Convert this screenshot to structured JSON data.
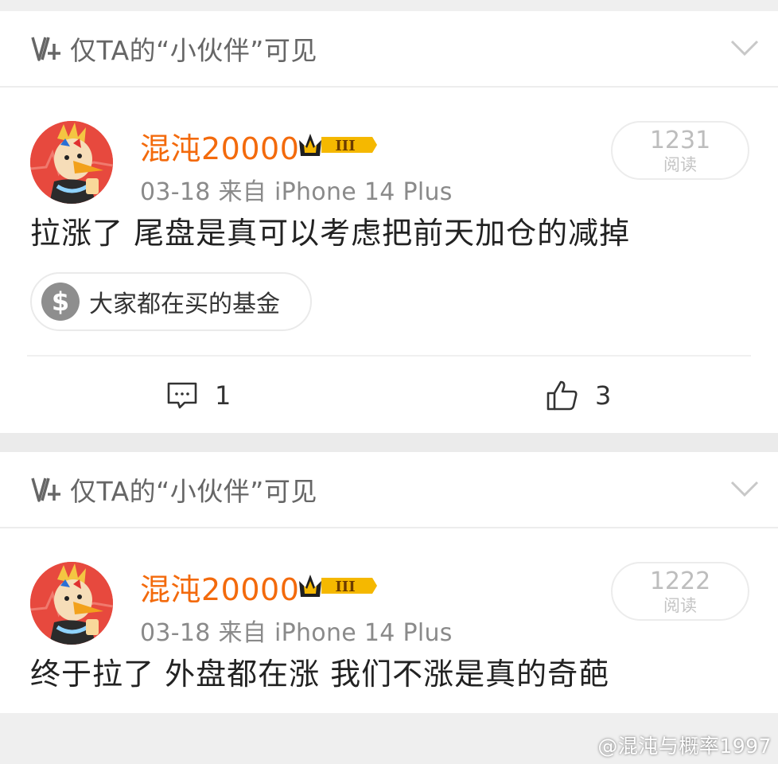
{
  "posts": [
    {
      "visibility": "仅TA的“小伙伴”可见",
      "username": "混沌20000",
      "badge_level": "III",
      "meta": "03-18  来自 iPhone 14 Plus",
      "reads_count": "1231",
      "reads_label": "阅读",
      "content": "拉涨了 尾盘是真可以考虑把前天加仓的减掉",
      "topic": "大家都在买的基金",
      "comments": "1",
      "likes": "3"
    },
    {
      "visibility": "仅TA的“小伙伴”可见",
      "username": "混沌20000",
      "badge_level": "III",
      "meta": "03-18  来自 iPhone 14 Plus",
      "reads_count": "1222",
      "reads_label": "阅读",
      "content": "终于拉了  外盘都在涨  我们不涨是真的奇葩"
    }
  ],
  "watermark": "@混沌与概率1997",
  "colors": {
    "username": "#f36a0c",
    "badge_gold": "#f5b800",
    "avatar_bg": "#e7493e"
  }
}
